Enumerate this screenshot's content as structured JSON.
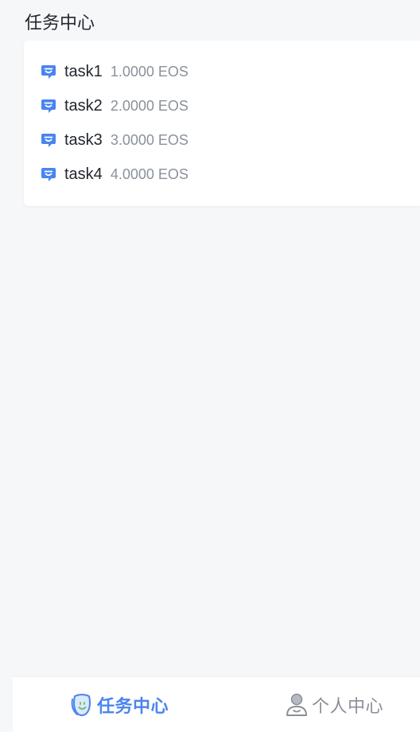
{
  "header": {
    "title": "任务中心"
  },
  "tasks": [
    {
      "name": "task1",
      "reward": "1.0000 EOS",
      "icon": "chat-bubble-icon"
    },
    {
      "name": "task2",
      "reward": "2.0000 EOS",
      "icon": "chat-bubble-icon"
    },
    {
      "name": "task3",
      "reward": "3.0000 EOS",
      "icon": "chat-bubble-icon"
    },
    {
      "name": "task4",
      "reward": "4.0000 EOS",
      "icon": "chat-bubble-icon"
    }
  ],
  "tabbar": {
    "tabs": [
      {
        "label": "任务中心",
        "icon": "task-center-icon",
        "active": true
      },
      {
        "label": "个人中心",
        "icon": "user-icon",
        "active": false
      }
    ]
  },
  "colors": {
    "accent": "#4a84f0",
    "page_background": "#f6f7f9",
    "text_primary": "#23272f",
    "text_secondary": "#8a919c"
  }
}
